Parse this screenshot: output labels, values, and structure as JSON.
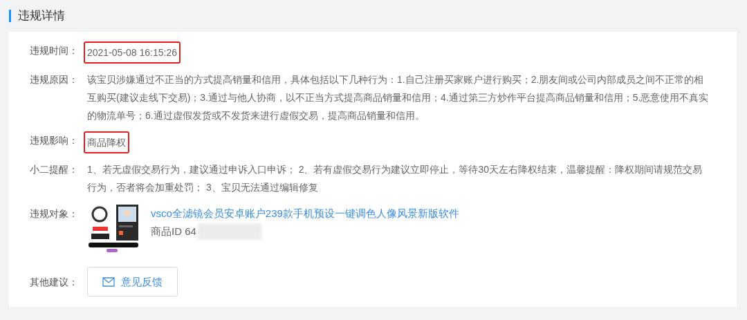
{
  "section_title": "违规详情",
  "fields": [
    {
      "kind": "text",
      "label": "违规时间：",
      "value": "2021-05-08 16:15:26",
      "highlighted": true
    },
    {
      "kind": "text",
      "label": "违规原因：",
      "value": "该宝贝涉嫌通过不正当的方式提高销量和信用，具体包括以下几种行为：1.自己注册买家账户进行购买；2.朋友间或公司内部成员之间不正常的相互购买(建议走线下交易)；3.通过与他人协商，以不正当方式提高商品销量和信用；4.通过第三方炒作平台提高商品销量和信用；5.恶意使用不真实的物流单号；6.通过虚假发货或不发货来进行虚假交易，提高商品销量和信用。",
      "highlighted": false
    },
    {
      "kind": "text",
      "label": "违规影响：",
      "value": "商品降权",
      "highlighted": true
    },
    {
      "kind": "text",
      "label": "小二提醒：",
      "value": "1、若无虚假交易行为，建议通过申诉入口申诉； 2、若有虚假交易行为建议立即停止，等待30天左右降权结束，温馨提醒：降权期间请规范交易行为，否者将会加重处罚； 3、宝贝无法通过编辑修复",
      "highlighted": false
    },
    {
      "kind": "product",
      "label": "违规对象：",
      "title": "vsco全滤镜会员安卓账户239款手机预设一键调色人像风景新版软件",
      "id_text": "商品ID 64"
    },
    {
      "kind": "button",
      "label": "其他建议：",
      "button": "意见反馈"
    }
  ]
}
